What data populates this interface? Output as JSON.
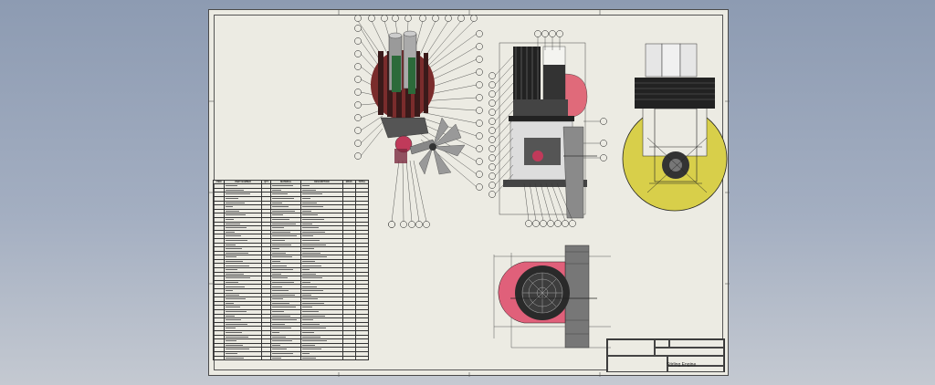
{
  "window": {
    "background": "viewer-canvas"
  },
  "sheet": {
    "title": "Stirling Engine",
    "bom_headers": [
      "ITEM",
      "PART NUMBER",
      "QTY",
      "MATERIAL",
      "DESCRIPTION",
      "MASS",
      "TOTAL"
    ],
    "bom_row_count": 42
  },
  "colors": {
    "sheet": "#ecebe3",
    "yellow_body": "#d8cf4a",
    "pink_body": "#e0607a",
    "dark_part": "#2a2a2a",
    "dim_line": "#2a2a2a"
  },
  "icons": [
    "callout-balloon-icon",
    "dimension-line-icon"
  ]
}
